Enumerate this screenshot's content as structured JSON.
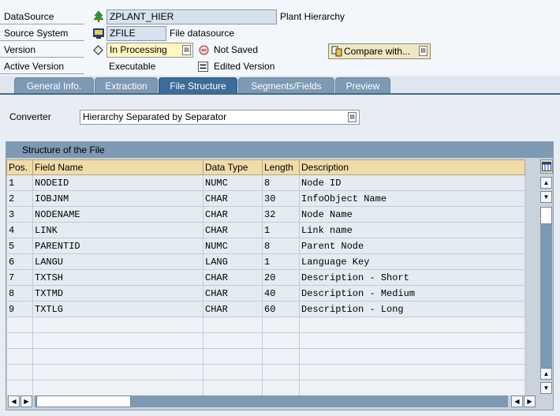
{
  "header": {
    "datasource": {
      "label": "DataSource",
      "value": "ZPLANT_HIER",
      "description": "Plant Hierarchy"
    },
    "source_system": {
      "label": "Source System",
      "value": "ZFILE",
      "description": "File datasource"
    },
    "version": {
      "label": "Version",
      "value": "In Processing",
      "state": "Not Saved",
      "compare_label": "Compare with..."
    },
    "active_version": {
      "label": "Active Version",
      "value": "Executable",
      "edited": "Edited Version"
    }
  },
  "tabs": [
    {
      "label": "General Info."
    },
    {
      "label": "Extraction"
    },
    {
      "label": "File Structure"
    },
    {
      "label": "Segments/Fields"
    },
    {
      "label": "Preview"
    }
  ],
  "converter": {
    "label": "Converter",
    "value": "Hierarchy Separated by Separator"
  },
  "structure": {
    "title": "Structure of the File",
    "columns": [
      "Pos.",
      "Field Name",
      "Data Type",
      "Length",
      "Description"
    ],
    "rows": [
      [
        "1",
        "NODEID",
        "NUMC",
        "8",
        "Node ID"
      ],
      [
        "2",
        "IOBJNM",
        "CHAR",
        "30",
        "InfoObject Name"
      ],
      [
        "3",
        "NODENAME",
        "CHAR",
        "32",
        "Node Name"
      ],
      [
        "4",
        "LINK",
        "CHAR",
        "1",
        "Link name"
      ],
      [
        "5",
        "PARENTID",
        "NUMC",
        "8",
        "Parent Node"
      ],
      [
        "6",
        "LANGU",
        "LANG",
        "1",
        "Language Key"
      ],
      [
        "7",
        "TXTSH",
        "CHAR",
        "20",
        "Description - Short"
      ],
      [
        "8",
        "TXTMD",
        "CHAR",
        "40",
        "Description - Medium"
      ],
      [
        "9",
        "TXTLG",
        "CHAR",
        "60",
        "Description - Long"
      ]
    ]
  },
  "colors": {
    "tab_active": "#3d6c98",
    "tab_inactive": "#7e99b3",
    "header_cell": "#f0dca8",
    "processing_field": "#fff7c0"
  },
  "icons": {
    "datasource": "tree-icon",
    "source_system": "file-system-icon",
    "state": "not-saved-icon",
    "compare": "compare-icon"
  }
}
